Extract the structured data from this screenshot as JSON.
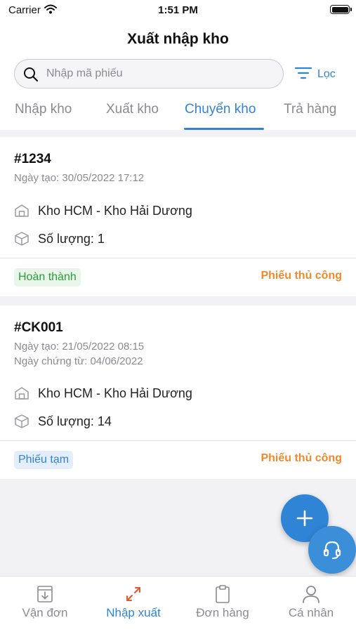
{
  "status_bar": {
    "carrier": "Carrier",
    "time": "1:51 PM"
  },
  "header": {
    "title": "Xuất nhập kho"
  },
  "search": {
    "placeholder": "Nhập mã phiếu"
  },
  "filter": {
    "label": "Lọc",
    "icon": "filter-icon"
  },
  "tabs": [
    {
      "label": "Nhập kho",
      "active": false
    },
    {
      "label": "Xuất kho",
      "active": false
    },
    {
      "label": "Chuyển kho",
      "active": true
    },
    {
      "label": "Trả hàng",
      "active": false
    }
  ],
  "cards": [
    {
      "code": "#1234",
      "created": "Ngày tạo: 30/05/2022 17:12",
      "route": "Kho HCM - Kho Hải Dương",
      "quantity": "Số lượng: 1",
      "status": "Hoàn thành",
      "status_color": "#2e9a3a",
      "type": "Phiếu thủ công"
    },
    {
      "code": "#CK001",
      "created": "Ngày tạo: 21/05/2022 08:15",
      "doc_date": "Ngày chứng từ: 04/06/2022",
      "route": "Kho HCM - Kho Hải Dương",
      "quantity": "Số lượng: 14",
      "status": "Phiếu tạm",
      "status_color": "#2f84d6",
      "type": "Phiếu thủ công"
    }
  ],
  "bottom_nav": [
    {
      "label": "Vận đơn",
      "icon": "inbox-download-icon",
      "active": false
    },
    {
      "label": "Nhập xuất",
      "icon": "arrows-transfer-icon",
      "active": true
    },
    {
      "label": "Đơn hàng",
      "icon": "clipboard-icon",
      "active": false
    },
    {
      "label": "Cá nhân",
      "icon": "person-icon",
      "active": false
    }
  ],
  "colors": {
    "accent": "#2f84d6",
    "warning": "#ee8a2c",
    "success": "#2e9a3a",
    "background": "#f2f2f4"
  }
}
